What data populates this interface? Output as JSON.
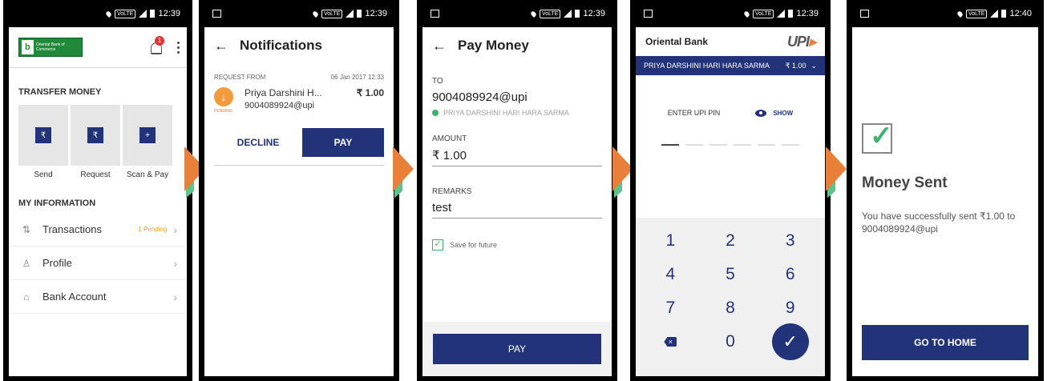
{
  "status": {
    "s1": "12:39",
    "s2": "12:39",
    "s3": "12:39",
    "s4": "12:39",
    "s5": "12:40",
    "volte": "VoLTE"
  },
  "screen1": {
    "logo_text": "Oriental Bank of Commerce",
    "notif_count": "1",
    "transfer_title": "TRANSFER MONEY",
    "tiles": [
      {
        "label": "Send",
        "glyph": "₹"
      },
      {
        "label": "Request",
        "glyph": "₹"
      },
      {
        "label": "Scan & Pay",
        "glyph": "+"
      }
    ],
    "info_title": "MY INFORMATION",
    "menu": [
      {
        "label": "Transactions",
        "icon": "transactions-icon",
        "badge": "1 Pending"
      },
      {
        "label": "Profile",
        "icon": "profile-icon",
        "badge": ""
      },
      {
        "label": "Bank Account",
        "icon": "bank-icon",
        "badge": ""
      }
    ]
  },
  "screen2": {
    "title": "Notifications",
    "request_from": "REQUEST FROM",
    "date": "06 Jan 2017 12:33",
    "name": "Priya Darshini H...",
    "upi": "9004089924@upi",
    "amount": "₹ 1.00",
    "pending": "PENDING",
    "decline": "DECLINE",
    "pay": "PAY"
  },
  "screen3": {
    "title": "Pay Money",
    "to_label": "TO",
    "to_value": "9004089924@upi",
    "verified_name": "PRIYA DARSHINI HARI HARA SARMA",
    "amount_label": "AMOUNT",
    "amount_value": "₹ 1.00",
    "remarks_label": "REMARKS",
    "remarks_value": "test",
    "save_label": "Save for future",
    "pay_button": "PAY"
  },
  "screen4": {
    "bank": "Oriental Bank",
    "upi_logo": "UPI",
    "payee": "PRIYA DARSHINI HARI HARA SARMA",
    "amount": "₹ 1.00",
    "enter_pin": "ENTER UPI PIN",
    "show": "SHOW",
    "keys": [
      "1",
      "2",
      "3",
      "4",
      "5",
      "6",
      "7",
      "8",
      "9",
      "",
      "0",
      ""
    ]
  },
  "screen5": {
    "title": "Money Sent",
    "message": "You have successfully sent ₹1.00 to 9004089924@upi",
    "button": "GO TO HOME"
  },
  "colors": {
    "navy": "#22337a",
    "orange": "#e8803a",
    "green": "#3cb371"
  }
}
